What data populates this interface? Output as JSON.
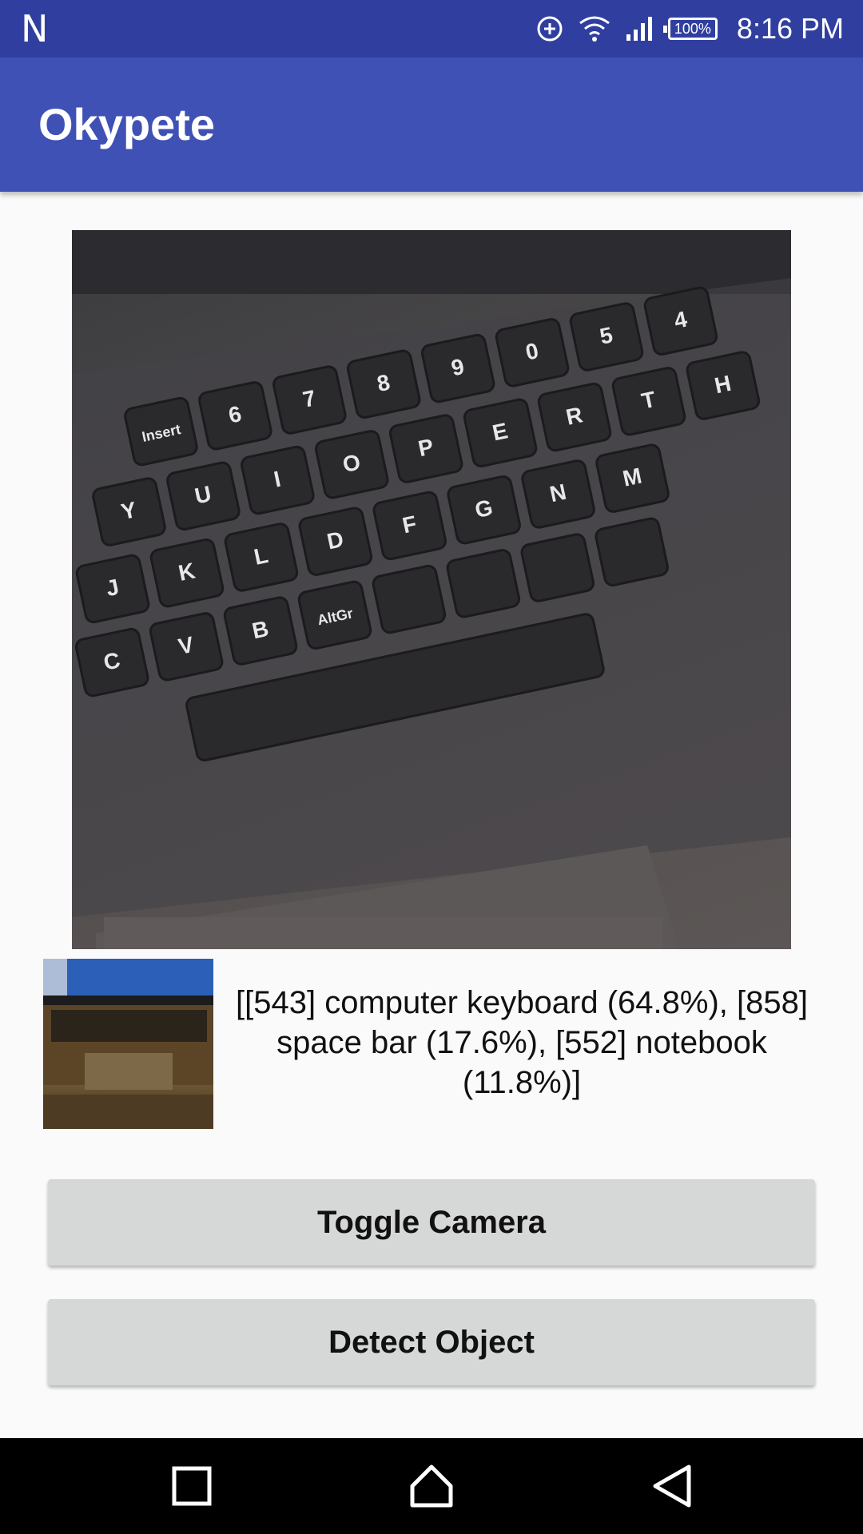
{
  "status_bar": {
    "notification_icon": "N",
    "battery": "100%",
    "time": "8:16 PM",
    "icons": [
      "data-saver-icon",
      "wifi-icon",
      "signal-icon",
      "battery-icon"
    ]
  },
  "app_bar": {
    "title": "Okypete"
  },
  "preview": {
    "description_icon": "camera-preview-image",
    "keys": [
      "Insert",
      "6",
      "7",
      "8",
      "9",
      "0",
      "5",
      "4",
      "Y",
      "U",
      "I",
      "O",
      "P",
      "E",
      "R",
      "T",
      "H",
      "J",
      "K",
      "L",
      "D",
      "F",
      "G",
      "N",
      "M",
      "C",
      "V",
      "B",
      "AltGr"
    ]
  },
  "thumbnail": {
    "icon": "captured-thumbnail-image"
  },
  "result": {
    "text": "[[543] computer keyboard (64.8%), [858] space bar (17.6%), [552] notebook (11.8%)]"
  },
  "buttons": {
    "toggle_camera": "Toggle Camera",
    "detect_object": "Detect Object"
  },
  "nav_bar": {
    "icons": [
      "recents-icon",
      "home-icon",
      "back-icon"
    ]
  },
  "colors": {
    "status_bar": "#303f9f",
    "app_bar": "#3f51b5",
    "button": "#d6d7d7"
  }
}
